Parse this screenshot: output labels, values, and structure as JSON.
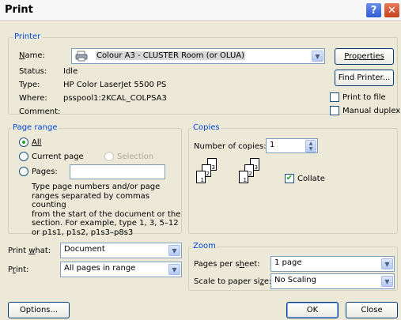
{
  "window": {
    "title": "Print",
    "help": "?",
    "close": "✕"
  },
  "printer": {
    "legend": "Printer",
    "name_label": "Name:",
    "name_value": "Colour A3 - CLUSTER Room (or OLUA)",
    "status_label": "Status:",
    "status_value": "Idle",
    "type_label": "Type:",
    "type_value": "HP Color LaserJet 5500 PS",
    "where_label": "Where:",
    "where_value": "psspool1:2KCAL_COLPSA3",
    "comment_label": "Comment:",
    "properties_button": "Properties",
    "find_printer_button": "Find Printer...",
    "print_to_file": "Print to file",
    "manual_duplex": "Manual duplex"
  },
  "page_range": {
    "legend": "Page range",
    "all": "All",
    "current_page": "Current page",
    "selection": "Selection",
    "pages": "Pages:",
    "pages_value": "",
    "hint": [
      "Type page numbers and/or page",
      "ranges separated by commas counting",
      "from the start of the document or the",
      "section. For example, type 1, 3, 5–12",
      "or p1s1, p1s2, p1s3–p8s3"
    ]
  },
  "copies": {
    "legend": "Copies",
    "number_label": "Number of copies:",
    "number_value": "1",
    "collate": "Collate",
    "page_numbers": [
      "3",
      "2",
      "1",
      "3",
      "2",
      "1"
    ]
  },
  "print_what": {
    "label": "Print what:",
    "value": "Document"
  },
  "print": {
    "label": "Print:",
    "value": "All pages in range"
  },
  "zoom": {
    "legend": "Zoom",
    "pages_per_sheet_label": "Pages per sheet:",
    "pages_per_sheet_value": "1 page",
    "scale_label": "Scale to paper size:",
    "scale_value": "No Scaling"
  },
  "buttons": {
    "options": "Options...",
    "ok": "OK",
    "close": "Close"
  },
  "colors": {
    "legend": "#0046d5",
    "check": "#21a121"
  }
}
